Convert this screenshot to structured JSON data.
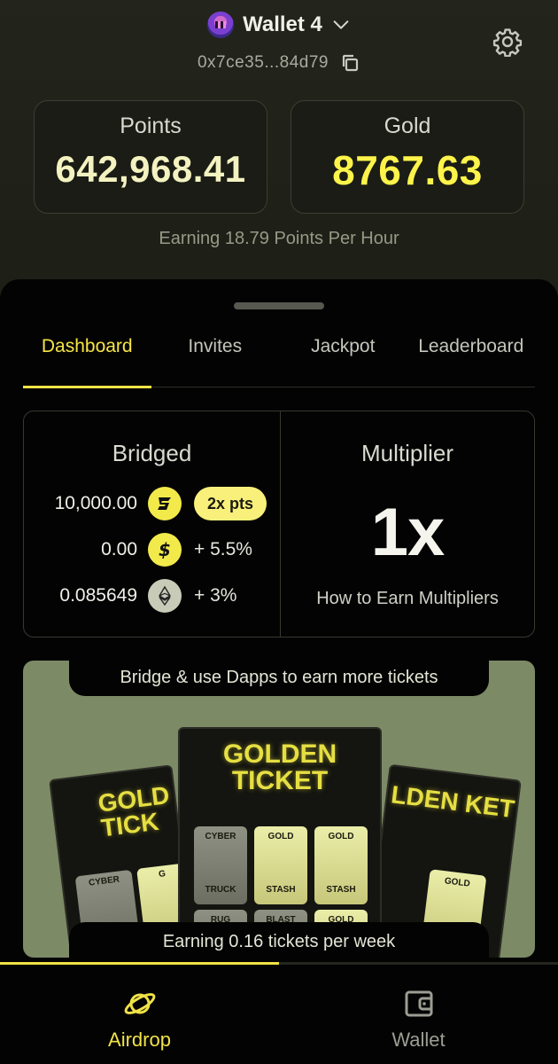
{
  "header": {
    "wallet_name": "Wallet 4",
    "address": "0x7ce35...84d79"
  },
  "stats": {
    "points_label": "Points",
    "points_value": "642,968.41",
    "gold_label": "Gold",
    "gold_value": "8767.63",
    "earning_text": "Earning 18.79 Points Per Hour"
  },
  "tabs": [
    {
      "label": "Dashboard",
      "active": true
    },
    {
      "label": "Invites",
      "active": false
    },
    {
      "label": "Jackpot",
      "active": false
    },
    {
      "label": "Leaderboard",
      "active": false
    }
  ],
  "bridged": {
    "title": "Bridged",
    "rows": [
      {
        "value": "10,000.00",
        "icon": "blast-icon",
        "extra": "2x pts"
      },
      {
        "value": "0.00",
        "icon": "dollar-icon",
        "extra": "+ 5.5%"
      },
      {
        "value": "0.085649",
        "icon": "ethereum-icon",
        "extra": "+ 3%"
      }
    ]
  },
  "multiplier": {
    "title": "Multiplier",
    "value": "1x",
    "link": "How to Earn Multipliers"
  },
  "promo": {
    "banner": "Bridge & use Dapps to earn more tickets",
    "footer": "Earning 0.16 tickets per week",
    "ticket_title_center": "GOLDEN TICKET",
    "ticket_title_left": "GOLD TICK",
    "ticket_title_right": "LDEN KET",
    "cells_center": [
      "CYBER",
      "GOLD",
      "GOLD",
      "TRUCK",
      "STASH",
      "STASH",
      "RUG",
      "BLAST",
      "GOLD"
    ],
    "cells_left": [
      "CYBER",
      "G"
    ],
    "cells_right": [
      "GOLD"
    ]
  },
  "colors": {
    "accent": "#f0e247",
    "gold_value": "#fdf34a",
    "promo_bg": "#7d8a66",
    "background": "#030303"
  },
  "tab_progress": 0.5,
  "bottom_nav": [
    {
      "label": "Airdrop",
      "icon": "planet-icon",
      "active": true
    },
    {
      "label": "Wallet",
      "icon": "wallet-icon",
      "active": false
    }
  ]
}
